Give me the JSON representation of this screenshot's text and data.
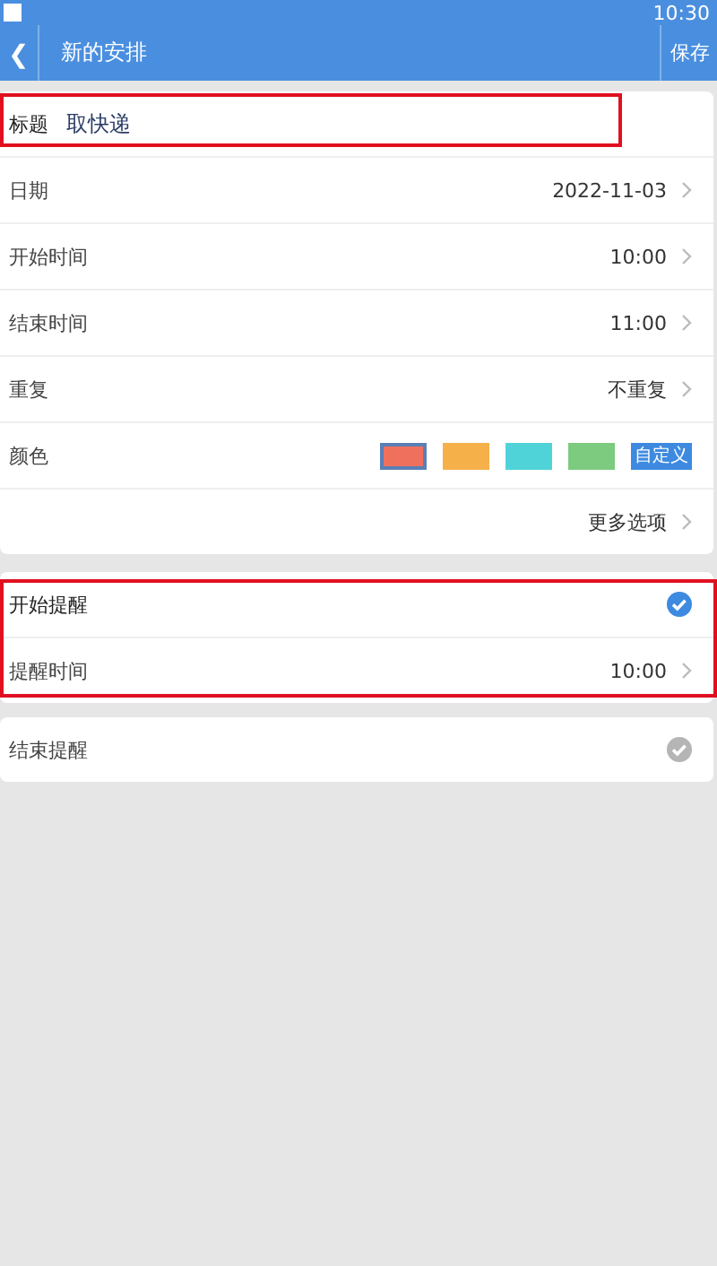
{
  "status_bar": {
    "time": "10:30"
  },
  "header": {
    "back": "❮",
    "title": "新的安排",
    "save": "保存"
  },
  "title_row": {
    "label": "标题",
    "value": "取快递",
    "highlighted": true
  },
  "rows": [
    {
      "label": "日期",
      "value": "2022-11-03"
    },
    {
      "label": "开始时间",
      "value": "10:00"
    },
    {
      "label": "结束时间",
      "value": "11:00"
    },
    {
      "label": "重复",
      "value": "不重复"
    }
  ],
  "color_row": {
    "label": "颜色",
    "swatches": [
      {
        "color": "#f0705e",
        "selected": true
      },
      {
        "color": "#f5b04a",
        "selected": false
      },
      {
        "color": "#4fd3d8",
        "selected": false
      },
      {
        "color": "#7ccb7e",
        "selected": false
      }
    ],
    "custom": "自定义"
  },
  "more": "更多选项",
  "start_reminder": {
    "label": "开始提醒",
    "checked": true,
    "highlighted": true,
    "time_label": "提醒时间",
    "time": "10:00"
  },
  "end_reminder": {
    "label": "结束提醒",
    "checked": false
  }
}
